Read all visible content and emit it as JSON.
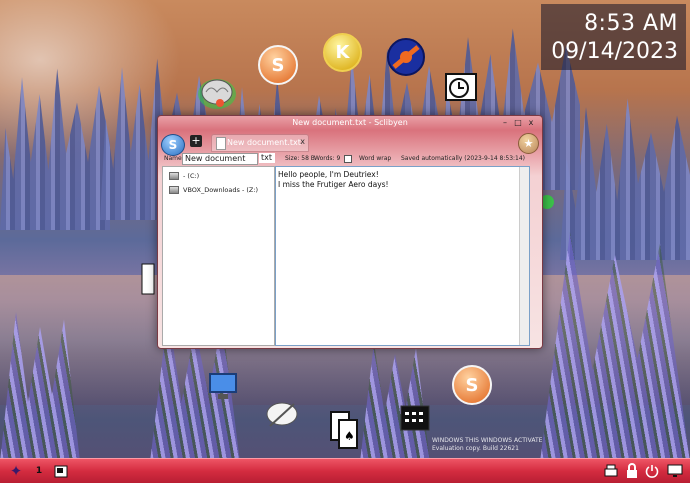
{
  "clock": {
    "time": "8:53 AM",
    "date": "09/14/2023"
  },
  "desktop_icons": [
    {
      "name": "brain-icon"
    },
    {
      "name": "s-app-icon",
      "glyph": "S"
    },
    {
      "name": "k-app-icon",
      "glyph": "K"
    },
    {
      "name": "blue-orb-icon"
    },
    {
      "name": "clock-app-icon"
    }
  ],
  "window": {
    "title": "New document.txt - Sclibyen",
    "app_button_glyph": "S",
    "new_tab_glyph": "+",
    "tab_title": "New document.txt",
    "tab_close": "x",
    "name_label": "Name:",
    "name_value": "New document",
    "extension": "txt",
    "size": "Size: 58 B",
    "words": "Words: 9",
    "word_wrap": "Word wrap",
    "saved": "Saved automatically (2023-9-14 8:53:14)",
    "drives": [
      "- (C:)",
      "VBOX_Downloads - (Z:)"
    ],
    "editor_lines": [
      "Hello people, I'm Deutriex!",
      "I miss the Frutiger Aero days!"
    ],
    "controls": {
      "min": "–",
      "max": "□",
      "close": "x"
    }
  },
  "watermark": {
    "line1": "WINDOWS THIS WINDOWS ACTIVATE",
    "line2": "Evaluation copy. Build 22621"
  },
  "taskbar": {
    "start_glyph": "✦",
    "item_label": "1"
  },
  "colors": {
    "taskbar": "#d42c40",
    "window_accent": "#d9727c",
    "clock_bg": "#14142a"
  }
}
